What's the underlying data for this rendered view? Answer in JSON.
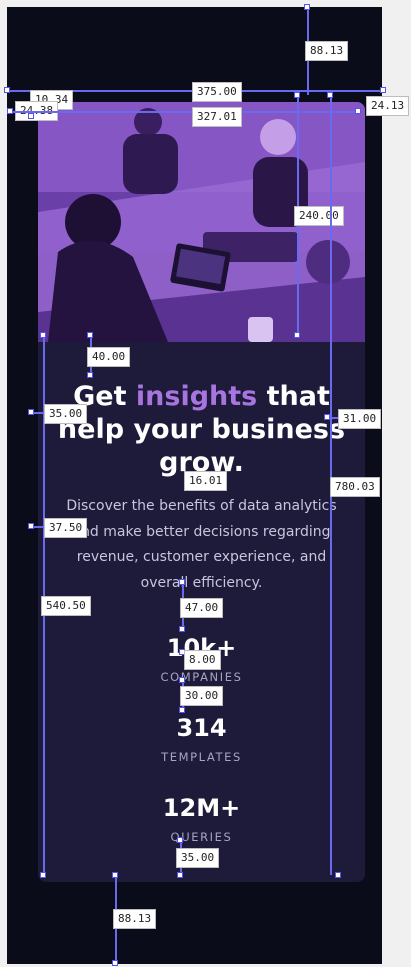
{
  "hero": {
    "headline_part1": "Get ",
    "headline_accent": "insights",
    "headline_part2": " that help your business grow.",
    "description": "Discover the benefits of data analytics and make better decisions regarding revenue, customer experience, and overall efficiency.",
    "accent_color": "#a874e0",
    "card_color": "#1d1a3a",
    "background_color": "#0a0c1a"
  },
  "stats": [
    {
      "value": "10k+",
      "label": "COMPANIES"
    },
    {
      "value": "314",
      "label": "TEMPLATES"
    },
    {
      "value": "12M+",
      "label": "QUERIES"
    }
  ],
  "measurements": {
    "top_spacing": "88.13",
    "bottom_spacing": "88.13",
    "frame_width": "375.00",
    "card_width": "327.01",
    "left_inset_a": "10.34",
    "left_inset_b": "24.38",
    "right_inset": "24.13",
    "image_height": "240.00",
    "image_to_title": "40.00",
    "title_left": "35.00",
    "title_right": "31.00",
    "title_to_desc": "16.01",
    "desc_left": "37.50",
    "card_height": "780.03",
    "content_height": "540.50",
    "desc_to_stats": "47.00",
    "stat_gap": "8.00",
    "stat_spacing": "30.00",
    "bottom_padding": "35.00"
  }
}
